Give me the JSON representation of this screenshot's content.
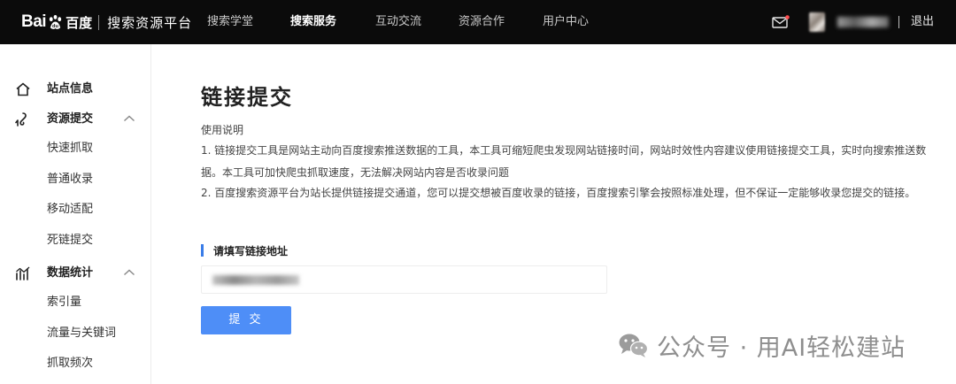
{
  "header": {
    "logo_bai": "Bai",
    "logo_du": "百度",
    "logo_sub": "搜索资源平台",
    "nav": [
      "搜索学堂",
      "搜索服务",
      "互动交流",
      "资源合作",
      "用户中心"
    ],
    "logout": "退出",
    "mail_badge_color": "#ff4d4f",
    "icons": [
      "paw-icon",
      "mail-icon"
    ]
  },
  "sidebar": {
    "groups": [
      {
        "label": "站点信息",
        "icon": "home-icon",
        "items": []
      },
      {
        "label": "资源提交",
        "icon": "submit-icon",
        "expanded": true,
        "items": [
          "快速抓取",
          "普通收录",
          "移动适配",
          "死链提交"
        ]
      },
      {
        "label": "数据统计",
        "icon": "stats-icon",
        "expanded": true,
        "items": [
          "索引量",
          "流量与关键词",
          "抓取频次"
        ]
      }
    ]
  },
  "main": {
    "title": "链接提交",
    "usage_title": "使用说明",
    "usage_lines": [
      "1. 链接提交工具是网站主动向百度搜索推送数据的工具，本工具可缩短爬虫发现网站链接时间，网站时效性内容建议使用链接提交工具，实时向搜索推送数",
      "据。本工具可加快爬虫抓取速度，无法解决网站内容是否收录问题",
      "2. 百度搜索资源平台为站长提供链接提交通道，您可以提交想被百度收录的链接，百度搜索引擎会按照标准处理，但不保证一定能够收录您提交的链接。"
    ],
    "section_label": "请填写链接地址",
    "submit_label": "提 交",
    "accent_color": "#4e8ef7"
  },
  "watermark": {
    "text": "公众号 · 用AI轻松建站",
    "icon": "wechat-icon"
  }
}
